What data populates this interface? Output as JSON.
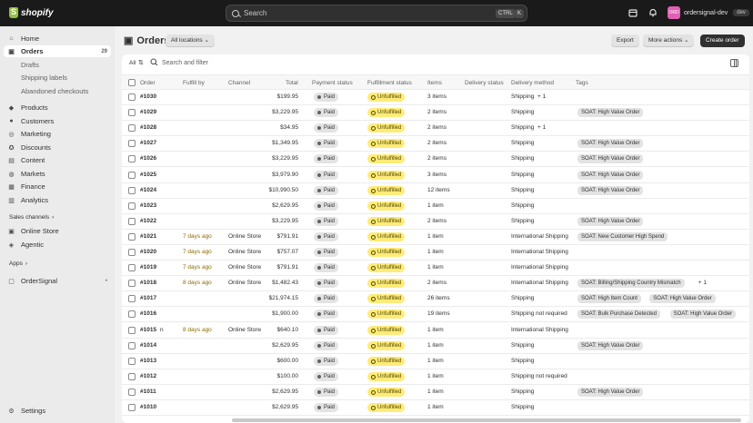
{
  "topbar": {
    "logo_text": "shopify",
    "search_placeholder": "Search",
    "kbd_ctrl": "CTRL",
    "kbd_k": "K",
    "store_initials": "ORD",
    "store_name": "ordersignal-dev",
    "store_badge": "dev"
  },
  "sidebar": {
    "home": "Home",
    "orders": "Orders",
    "orders_count": "29",
    "drafts": "Drafts",
    "shipping_labels": "Shipping labels",
    "abandoned": "Abandoned checkouts",
    "products": "Products",
    "customers": "Customers",
    "marketing": "Marketing",
    "discounts": "Discounts",
    "content": "Content",
    "markets": "Markets",
    "finance": "Finance",
    "analytics": "Analytics",
    "sales_channels": "Sales channels",
    "online_store": "Online Store",
    "agentic": "Agentic",
    "apps": "Apps",
    "ordersignal": "OrderSignal",
    "settings": "Settings"
  },
  "header": {
    "title": "Orders",
    "locations": "All locations",
    "export": "Export",
    "more_actions": "More actions",
    "create_order": "Create order"
  },
  "filter": {
    "all": "All",
    "search_filter": "Search and filter"
  },
  "columns": {
    "order": "Order",
    "fulfill_by": "Fulfill by",
    "channel": "Channel",
    "total": "Total",
    "payment_status": "Payment status",
    "fulfillment_status": "Fulfillment status",
    "items": "Items",
    "delivery_status": "Delivery status",
    "delivery_method": "Delivery method",
    "tags": "Tags"
  },
  "rows": [
    {
      "order": "#1030",
      "fulfill": "",
      "channel": "",
      "total": "$199.95",
      "payment": "Paid",
      "fulfillment": "Unfulfilled",
      "items": "3 items",
      "delivery_method": "Shipping",
      "method_extra": "+ 1",
      "tags": []
    },
    {
      "order": "#1029",
      "fulfill": "",
      "channel": "",
      "total": "$3,229.95",
      "payment": "Paid",
      "fulfillment": "Unfulfilled",
      "items": "2 items",
      "delivery_method": "Shipping",
      "method_extra": "",
      "tags": [
        "SOAT: High Value Order"
      ]
    },
    {
      "order": "#1028",
      "fulfill": "",
      "channel": "",
      "total": "$34.95",
      "payment": "Paid",
      "fulfillment": "Unfulfilled",
      "items": "2 items",
      "delivery_method": "Shipping",
      "method_extra": "+ 1",
      "tags": []
    },
    {
      "order": "#1027",
      "fulfill": "",
      "channel": "",
      "total": "$1,349.95",
      "payment": "Paid",
      "fulfillment": "Unfulfilled",
      "items": "2 items",
      "delivery_method": "Shipping",
      "method_extra": "",
      "tags": [
        "SOAT: High Value Order"
      ]
    },
    {
      "order": "#1026",
      "fulfill": "",
      "channel": "",
      "total": "$3,229.95",
      "payment": "Paid",
      "fulfillment": "Unfulfilled",
      "items": "2 items",
      "delivery_method": "Shipping",
      "method_extra": "",
      "tags": [
        "SOAT: High Value Order"
      ]
    },
    {
      "order": "#1025",
      "fulfill": "",
      "channel": "",
      "total": "$3,979.90",
      "payment": "Paid",
      "fulfillment": "Unfulfilled",
      "items": "3 items",
      "delivery_method": "Shipping",
      "method_extra": "",
      "tags": [
        "SOAT: High Value Order"
      ]
    },
    {
      "order": "#1024",
      "fulfill": "",
      "channel": "",
      "total": "$10,990.50",
      "payment": "Paid",
      "fulfillment": "Unfulfilled",
      "items": "12 items",
      "delivery_method": "Shipping",
      "method_extra": "",
      "tags": [
        "SOAT: High Value Order"
      ]
    },
    {
      "order": "#1023",
      "fulfill": "",
      "channel": "",
      "total": "$2,629.95",
      "payment": "Paid",
      "fulfillment": "Unfulfilled",
      "items": "1 item",
      "delivery_method": "Shipping",
      "method_extra": "",
      "tags": []
    },
    {
      "order": "#1022",
      "fulfill": "",
      "channel": "",
      "total": "$3,229.95",
      "payment": "Paid",
      "fulfillment": "Unfulfilled",
      "items": "2 items",
      "delivery_method": "Shipping",
      "method_extra": "",
      "tags": [
        "SOAT: High Value Order"
      ]
    },
    {
      "order": "#1021",
      "fulfill": "7 days ago",
      "channel": "Online Store",
      "total": "$791.91",
      "payment": "Paid",
      "fulfillment": "Unfulfilled",
      "items": "1 item",
      "delivery_method": "International Shipping",
      "method_extra": "",
      "tags": [
        "SOAT: New Customer High Spend"
      ]
    },
    {
      "order": "#1020",
      "fulfill": "7 days ago",
      "channel": "Online Store",
      "total": "$757.07",
      "payment": "Paid",
      "fulfillment": "Unfulfilled",
      "items": "1 item",
      "delivery_method": "International Shipping",
      "method_extra": "",
      "tags": []
    },
    {
      "order": "#1019",
      "fulfill": "7 days ago",
      "channel": "Online Store",
      "total": "$791.91",
      "payment": "Paid",
      "fulfillment": "Unfulfilled",
      "items": "1 item",
      "delivery_method": "International Shipping",
      "method_extra": "",
      "tags": []
    },
    {
      "order": "#1018",
      "fulfill": "8 days ago",
      "channel": "Online Store",
      "total": "$1,482.43",
      "payment": "Paid",
      "fulfillment": "Unfulfilled",
      "items": "2 items",
      "delivery_method": "International Shipping",
      "method_extra": "",
      "tags": [
        "SOAT: Billing/Shipping Country Mismatch"
      ],
      "tags_extra": "+ 1"
    },
    {
      "order": "#1017",
      "fulfill": "",
      "channel": "",
      "total": "$21,974.15",
      "payment": "Paid",
      "fulfillment": "Unfulfilled",
      "items": "26 items",
      "delivery_method": "Shipping",
      "method_extra": "",
      "tags": [
        "SOAT: High Item Count",
        "SOAT: High Value Order"
      ]
    },
    {
      "order": "#1016",
      "fulfill": "",
      "channel": "",
      "total": "$1,900.00",
      "payment": "Paid",
      "fulfillment": "Unfulfilled",
      "items": "19 items",
      "delivery_method": "Shipping not required",
      "method_extra": "",
      "tags": [
        "SOAT: Bulk Purchase Detected",
        "SOAT: High Value Order"
      ]
    },
    {
      "order": "#1015",
      "fulfill": "8 days ago",
      "channel": "Online Store",
      "total": "$640.10",
      "payment": "Paid",
      "fulfillment": "Unfulfilled",
      "items": "1 item",
      "delivery_method": "International Shipping",
      "method_extra": "",
      "tags": [],
      "prefix": "n"
    },
    {
      "order": "#1014",
      "fulfill": "",
      "channel": "",
      "total": "$2,629.95",
      "payment": "Paid",
      "fulfillment": "Unfulfilled",
      "items": "1 item",
      "delivery_method": "Shipping",
      "method_extra": "",
      "tags": [
        "SOAT: High Value Order"
      ]
    },
    {
      "order": "#1013",
      "fulfill": "",
      "channel": "",
      "total": "$600.00",
      "payment": "Paid",
      "fulfillment": "Unfulfilled",
      "items": "1 item",
      "delivery_method": "Shipping",
      "method_extra": "",
      "tags": []
    },
    {
      "order": "#1012",
      "fulfill": "",
      "channel": "",
      "total": "$100.00",
      "payment": "Paid",
      "fulfillment": "Unfulfilled",
      "items": "1 item",
      "delivery_method": "Shipping not required",
      "method_extra": "",
      "tags": []
    },
    {
      "order": "#1011",
      "fulfill": "",
      "channel": "",
      "total": "$2,629.95",
      "payment": "Paid",
      "fulfillment": "Unfulfilled",
      "items": "1 item",
      "delivery_method": "Shipping",
      "method_extra": "",
      "tags": [
        "SOAT: High Value Order"
      ]
    },
    {
      "order": "#1010",
      "fulfill": "",
      "channel": "",
      "total": "$2,629.95",
      "payment": "Paid",
      "fulfillment": "Unfulfilled",
      "items": "1 item",
      "delivery_method": "Shipping",
      "method_extra": "",
      "tags": []
    }
  ],
  "colors": {
    "topbar": "#1a1a1a",
    "sidebar": "#ebebeb",
    "unfulfilled": "#ffeb78",
    "paid": "#e3e3e3",
    "fulfill_by": "#8f6b00"
  }
}
